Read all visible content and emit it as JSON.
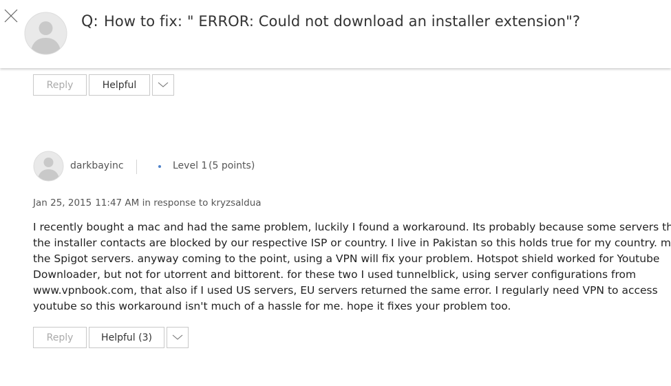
{
  "header": {
    "q_label": "Q:",
    "title": "How to fix: \" ERROR: Could not download an installer extension\"?",
    "close_icon": "close-icon",
    "avatar_icon": "default-avatar-icon"
  },
  "first_post": {
    "reply_label": "Reply",
    "helpful_label": "Helpful",
    "more_icon": "chevron-down-icon"
  },
  "second_post": {
    "username": "darkbayinc",
    "level": "Level 1",
    "points": "(5 points)",
    "date": "Jan 25, 2015",
    "time": "11:47 AM",
    "in_response_to": "in response to kryzsaldua",
    "body_lines": [
      "I recently bought a mac and had the same problem, luckily I found a workaround. Its probably because some servers that",
      "the installer contacts are blocked by our respective ISP or country. I live in Pakistan so this holds true for my country. maybe",
      "the Spigot servers. anyway coming to the point, using a VPN will fix your problem. Hotspot shield worked for Youtube",
      "Downloader, but not for utorrent and bittorent. for these two I used tunnelblick, using server configurations from",
      "www.vpnbook.com, that also if I used US servers, EU servers returned the same error. I regularly need VPN to access",
      "youtube so this workaround isn't much of a hassle for me. hope it fixes your problem too."
    ],
    "reply_label": "Reply",
    "helpful_label": "Helpful (3)",
    "more_icon": "chevron-down-icon"
  },
  "colors": {
    "level_dot": "#4f82c9",
    "border": "#c8c8c8"
  }
}
